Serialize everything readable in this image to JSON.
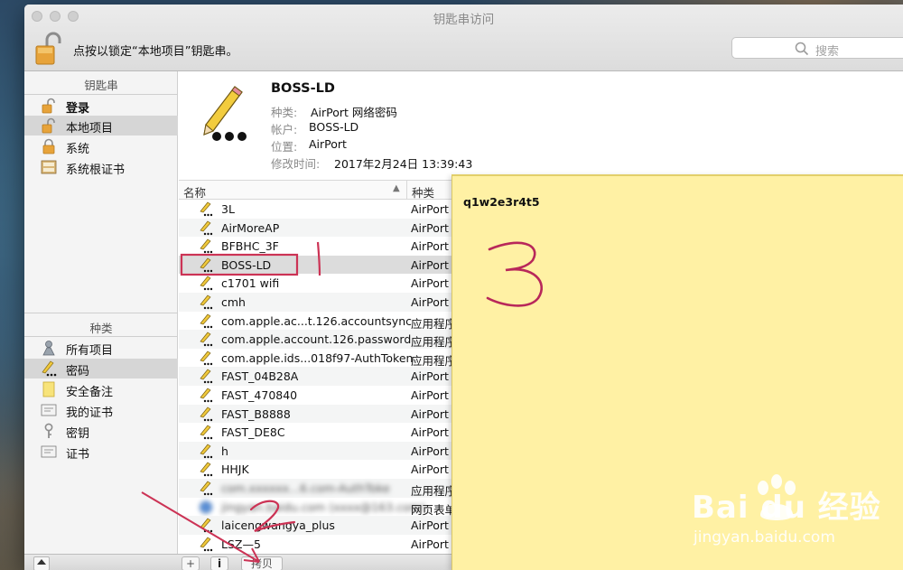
{
  "window": {
    "title": "钥匙串访问",
    "lock_hint": "点按以锁定“本地项目”钥匙串。",
    "search_placeholder": "搜索"
  },
  "sidebar": {
    "keychains_header": "钥匙串",
    "keychains": [
      {
        "label": "登录",
        "icon": "unlocked-padlock-icon",
        "bold": true
      },
      {
        "label": "本地项目",
        "icon": "unlocked-padlock-icon",
        "selected": true
      },
      {
        "label": "系统",
        "icon": "locked-padlock-icon"
      },
      {
        "label": "系统根证书",
        "icon": "certificate-cabinet-icon"
      }
    ],
    "categories_header": "种类",
    "categories": [
      {
        "label": "所有项目",
        "icon": "people-keys-icon"
      },
      {
        "label": "密码",
        "icon": "pencil-dots-icon",
        "selected": true
      },
      {
        "label": "安全备注",
        "icon": "note-icon"
      },
      {
        "label": "我的证书",
        "icon": "certificate-icon"
      },
      {
        "label": "密钥",
        "icon": "key-icon"
      },
      {
        "label": "证书",
        "icon": "certificate-icon"
      }
    ]
  },
  "detail": {
    "title": "BOSS-LD",
    "rows": [
      {
        "key": "种类:",
        "value": "AirPort 网络密码"
      },
      {
        "key": "帐户:",
        "value": "BOSS-LD"
      },
      {
        "key": "位置:",
        "value": "AirPort"
      },
      {
        "key": "修改时间:",
        "value": "2017年2月24日 13:39:43"
      }
    ]
  },
  "list": {
    "columns": {
      "name": "名称",
      "kind": "种类"
    },
    "rows": [
      {
        "name": "3L",
        "kind": "AirPort"
      },
      {
        "name": "AirMoreAP",
        "kind": "AirPort"
      },
      {
        "name": "BFBHC_3F",
        "kind": "AirPort"
      },
      {
        "name": "BOSS-LD",
        "kind": "AirPort",
        "selected": true
      },
      {
        "name": "c1701 wifi",
        "kind": "AirPort"
      },
      {
        "name": "cmh",
        "kind": "AirPort"
      },
      {
        "name": "com.apple.ac...t.126.accountsync",
        "kind": "应用程序"
      },
      {
        "name": "com.apple.account.126.password",
        "kind": "应用程序"
      },
      {
        "name": "com.apple.ids...018f97-AuthToken",
        "kind": "应用程序"
      },
      {
        "name": "FAST_04B28A",
        "kind": "AirPort"
      },
      {
        "name": "FAST_470840",
        "kind": "AirPort"
      },
      {
        "name": "FAST_B8888",
        "kind": "AirPort"
      },
      {
        "name": "FAST_DE8C",
        "kind": "AirPort"
      },
      {
        "name": "h",
        "kind": "AirPort"
      },
      {
        "name": "HHJK",
        "kind": "AirPort"
      },
      {
        "name": "com.xxxxxx...6.com-AuthToke",
        "kind": "应用程序",
        "blurred": true
      },
      {
        "name": "jingyan.baidu.com (xxxx@163.com)",
        "kind": "网页表单",
        "blurred": true,
        "icon": "globe-icon"
      },
      {
        "name": "laicengwangya_plus",
        "kind": "AirPort"
      },
      {
        "name": "LSZ—5",
        "kind": "AirPort"
      }
    ]
  },
  "bottom_bar": {
    "add": "+",
    "info": "i",
    "copy": "拷贝"
  },
  "sticky_note": {
    "text": "q1w2e3r4t5"
  },
  "watermark": {
    "brand": "Bai du 经验",
    "url": "jingyan.baidu.com"
  },
  "annotations": {
    "colors": {
      "box": "#cc3355",
      "ink": "#b8285a"
    }
  }
}
